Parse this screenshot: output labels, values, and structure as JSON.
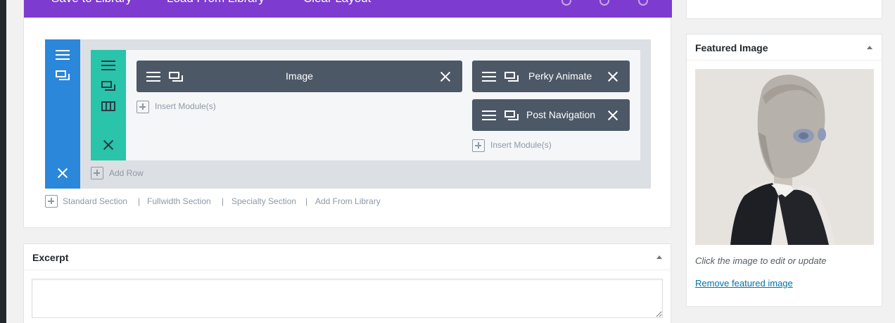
{
  "builder": {
    "toolbar": {
      "save_to_library": "Save to Library",
      "load_from_library": "Load From Library",
      "clear_layout": "Clear Layout"
    },
    "left_column": {
      "modules": [
        {
          "label": "Image"
        }
      ],
      "insert_label": "Insert Module(s)"
    },
    "right_column": {
      "modules": [
        {
          "label": "Perky Animate"
        },
        {
          "label": "Post Navigation"
        }
      ],
      "insert_label": "Insert Module(s)"
    },
    "add_row": "Add Row",
    "section_links": {
      "standard": "Standard Section",
      "fullwidth": "Fullwidth Section",
      "specialty": "Specialty Section",
      "library": "Add From Library",
      "separator": "|"
    },
    "colors": {
      "toolbar": "#7e3bd0",
      "section": "#2b87da",
      "row": "#29c4a9",
      "module": "#4c5866"
    }
  },
  "excerpt": {
    "title": "Excerpt",
    "value": ""
  },
  "featured_image": {
    "title": "Featured Image",
    "caption": "Click the image to edit or update",
    "remove_link": "Remove featured image"
  },
  "icons": {
    "drag": "menu-icon",
    "duplicate": "duplicate-icon",
    "delete": "close-icon",
    "columns": "columns-icon",
    "add": "plus-box-icon",
    "collapse": "triangle-up-icon"
  }
}
